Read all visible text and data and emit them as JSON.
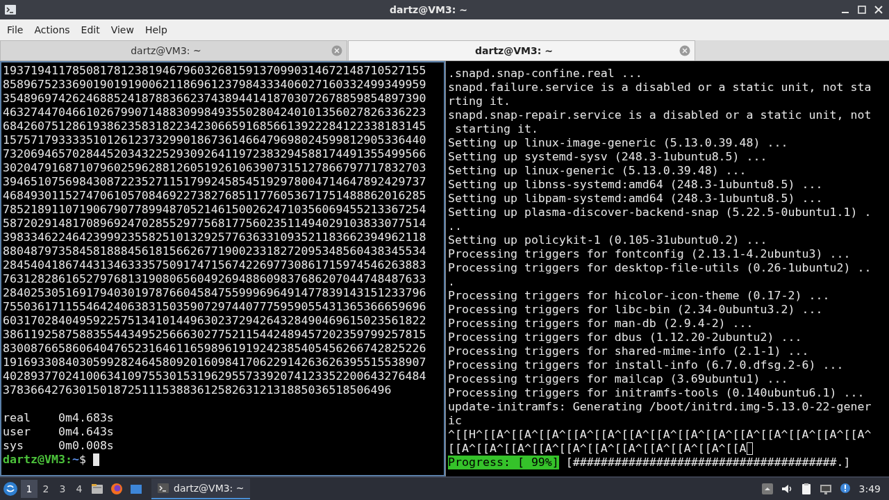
{
  "window": {
    "title": "dartz@VM3: ~"
  },
  "menu": [
    "File",
    "Actions",
    "Edit",
    "View",
    "Help"
  ],
  "tabs": [
    {
      "label": "dartz@VM3: ~",
      "selected": false
    },
    {
      "label": "dartz@VM3: ~",
      "selected": true
    }
  ],
  "left_pane": {
    "focused": true,
    "lines": [
      "1937194117850817812381946796032681591370990314672148710527155",
      "8589675233690190191900621186961237984333406027160332499349959",
      "3548969742624688524187883662374389441418703072678859854897390",
      "4632744704661026799071488309984935502804240101356027826336223",
      "6842607512861938623583182234230665916856613922284122338183145",
      "1575717933335101261237329901867361466479698024599812905336440",
      "7320694657028445203432252930926411972383294588174491355499566",
      "3020479168710796025962881260519261063907315127866797717832703",
      "3946510756984308722352711517992458545192978004714647892429737",
      "4684930115274706105708469227382768511776053671751488862016285",
      "7852189110719067907789948705214615002624710356069455213367254",
      "5872029148170896924702855297756817756023511494029103833077514",
      "3983346224642399923558251013292577636331093521183662394962118",
      "8804879735845818884561815662677190023318272095348560438345534",
      "2845404186744313463335750917471567422697730861715974546263883",
      "7631282861652797681319080656049269488609837686207044748487633",
      "2840253051691794030197876604584755999696491477839143151233796",
      "7550361711554642406383150359072974407775959055431365366659696",
      "6031702840495922575134101449630237294264328490469615023561822",
      "3861192587588355443495256663027752115442489457202359799257815",
      "8300876658606404765231646116598961919242385405456266742825226",
      "1916933084030599282464580920160984170622914263626395515538907",
      "4028937702410063410975530153196295573392074123352200643276484",
      "37836642763015018725111538836125826312131885036518506496"
    ],
    "timing": [
      {
        "label": "real",
        "value": "0m4.683s"
      },
      {
        "label": "user",
        "value": "0m4.643s"
      },
      {
        "label": "sys",
        "value": "0m0.008s"
      }
    ],
    "prompt": {
      "user": "dartz@VM3:",
      "path": "~",
      "symbol": "$"
    }
  },
  "right_pane": {
    "focused": false,
    "lines": [
      ".snapd.snap-confine.real ...",
      "snapd.failure.service is a disabled or a static unit, not sta",
      "rting it.",
      "snapd.snap-repair.service is a disabled or a static unit, not",
      " starting it.",
      "Setting up linux-image-generic (5.13.0.39.48) ...",
      "Setting up systemd-sysv (248.3-1ubuntu8.5) ...",
      "Setting up linux-generic (5.13.0.39.48) ...",
      "Setting up libnss-systemd:amd64 (248.3-1ubuntu8.5) ...",
      "Setting up libpam-systemd:amd64 (248.3-1ubuntu8.5) ...",
      "Setting up plasma-discover-backend-snap (5.22.5-0ubuntu1.1) .",
      "..",
      "Setting up policykit-1 (0.105-31ubuntu0.2) ...",
      "Processing triggers for fontconfig (2.13.1-4.2ubuntu3) ...",
      "Processing triggers for desktop-file-utils (0.26-1ubuntu2) ..",
      ".",
      "Processing triggers for hicolor-icon-theme (0.17-2) ...",
      "Processing triggers for libc-bin (2.34-0ubuntu3.2) ...",
      "Processing triggers for man-db (2.9.4-2) ...",
      "Processing triggers for dbus (1.12.20-2ubuntu2) ...",
      "Processing triggers for shared-mime-info (2.1-1) ...",
      "Processing triggers for install-info (6.7.0.dfsg.2-6) ...",
      "Processing triggers for mailcap (3.69ubuntu1) ...",
      "Processing triggers for initramfs-tools (0.140ubuntu6.1) ...",
      "update-initramfs: Generating /boot/initrd.img-5.13.0-22-gener",
      "ic",
      "^[[H^[[A^[[A^[[A^[[A^[[A^[[A^[[A^[[A^[[A^[[A^[[A^[[A^[[A^[[A^",
      "[[A^[[A^[[A^[[A^[[A^[[A^[[A^[[A^[[A^[[A^[[A"
    ],
    "progress": {
      "label": "Progress: [ 99%]",
      "bar": "[######################################.]"
    }
  },
  "taskbar": {
    "workspaces": [
      {
        "label": "1",
        "selected": true
      },
      {
        "label": "2",
        "selected": false
      },
      {
        "label": "3",
        "selected": false
      },
      {
        "label": "4",
        "selected": false
      }
    ],
    "task": {
      "label": "dartz@VM3: ~",
      "active": true
    },
    "clock": "3:49"
  }
}
